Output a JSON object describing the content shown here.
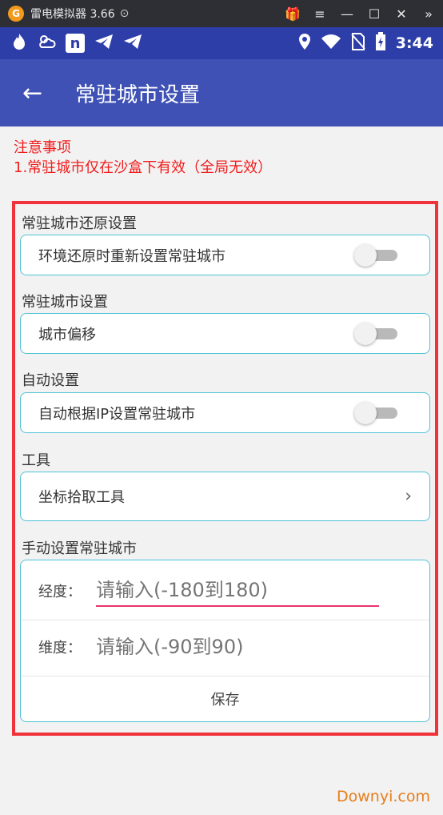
{
  "emulator": {
    "logo_glyph": "G",
    "title": "雷电模拟器 3.66",
    "gamepad_glyph": "⊙",
    "controls": [
      "🎁",
      "≡",
      "—",
      "☐",
      "✕",
      "»"
    ]
  },
  "status_bar": {
    "time": "3:44",
    "left_icons": [
      "flame-icon",
      "cloud-sun-icon",
      "n-icon",
      "telegram-icon",
      "telegram-icon"
    ],
    "right_icons": [
      "location-icon",
      "wifi-icon",
      "no-sim-icon",
      "battery-charging-icon"
    ]
  },
  "app_bar": {
    "back_glyph": "←",
    "title": "常驻城市设置"
  },
  "notice": {
    "title": "注意事项",
    "line1": "1.常驻城市仅在沙盒下有效（全局无效）"
  },
  "sections": {
    "restore": {
      "label": "常驻城市还原设置",
      "item": "环境还原时重新设置常驻城市",
      "enabled": false
    },
    "city": {
      "label": "常驻城市设置",
      "item": "城市偏移",
      "enabled": false
    },
    "auto": {
      "label": "自动设置",
      "item": "自动根据IP设置常驻城市",
      "enabled": false
    },
    "tools": {
      "label": "工具",
      "item": "坐标拾取工具",
      "chevron": "›"
    },
    "manual": {
      "label": "手动设置常驻城市",
      "longitude_label": "经度：",
      "longitude_placeholder": "请输入(-180到180)",
      "latitude_label": "维度：",
      "latitude_placeholder": "请输入(-90到90)",
      "save_label": "保存"
    }
  },
  "watermark": "Downyi.com",
  "colors": {
    "app_bar": "#3f51b5",
    "status_bar": "#2d3ea8",
    "notice_text": "#f21c1c",
    "frame": "#f0333a",
    "card_border": "#4fc3d7",
    "input_focus": "#e8336c",
    "watermark": "#e67e1b"
  }
}
